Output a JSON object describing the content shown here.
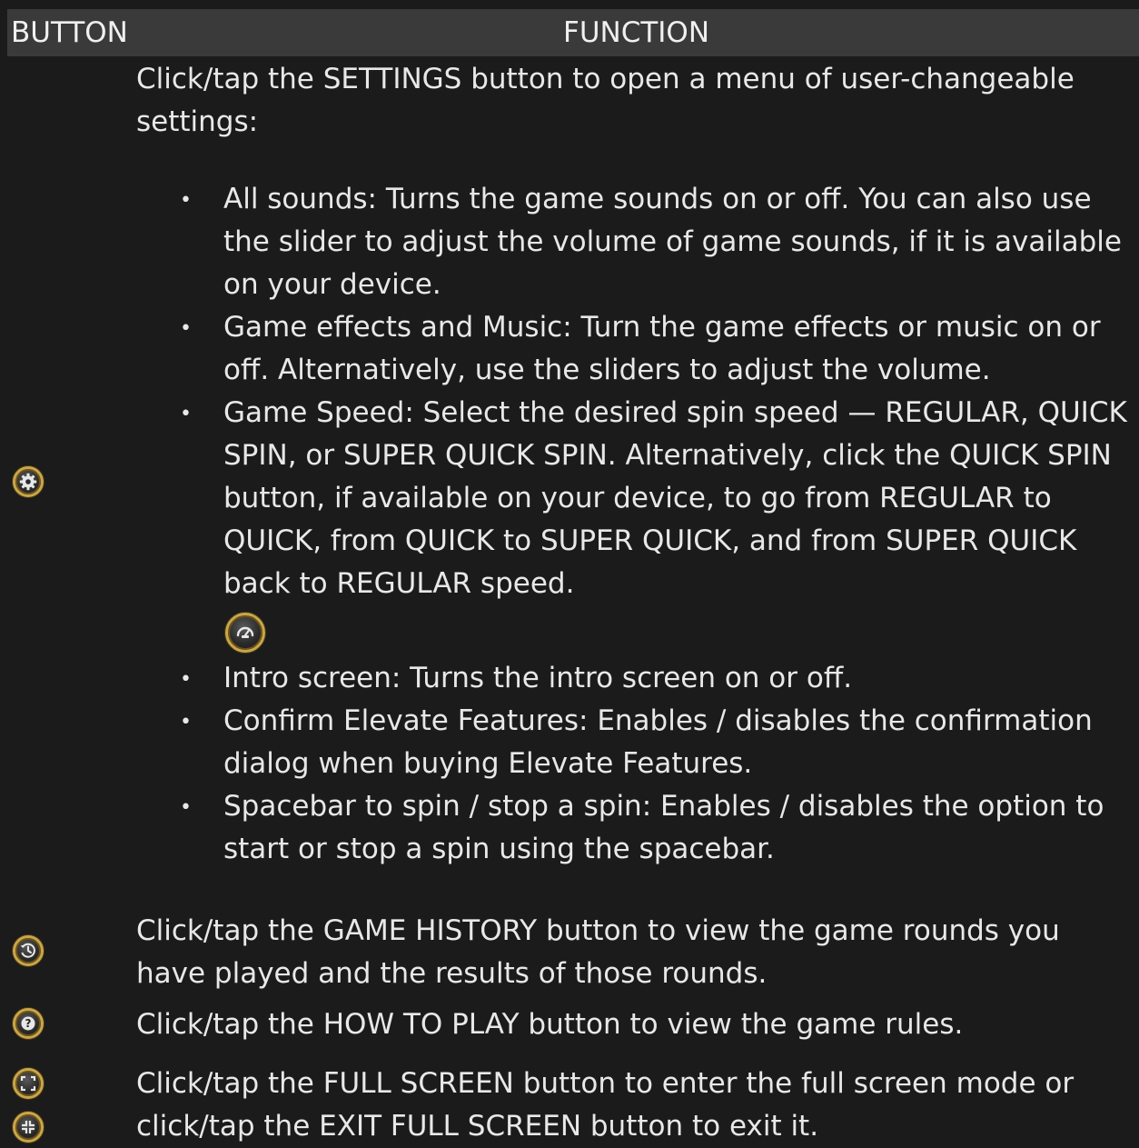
{
  "header": {
    "button_col": "BUTTON",
    "function_col": "FUNCTION"
  },
  "settings": {
    "icon": "settings-gear-icon",
    "intro_line1": "Click/tap the SETTINGS button to open a menu of user-changeable",
    "intro_line2": "settings:",
    "items": [
      {
        "lines": [
          "All sounds: Turns the game sounds on or off. You can also use",
          "the slider to adjust the volume of game sounds, if it is available",
          "on your device."
        ]
      },
      {
        "lines": [
          "Game effects and Music: Turn the game effects or music on or",
          "off. Alternatively, use the sliders to adjust the volume."
        ]
      },
      {
        "lines": [
          "Game Speed: Select the desired spin speed — REGULAR, QUICK",
          "SPIN, or SUPER QUICK SPIN. Alternatively, click the QUICK SPIN",
          "button, if available on your device, to go from REGULAR to",
          "QUICK, from QUICK to SUPER QUICK, and from SUPER QUICK",
          "back to REGULAR speed."
        ],
        "icon": "quick-spin-speedometer-icon"
      },
      {
        "lines": [
          "Intro screen: Turns the intro screen on or off."
        ]
      },
      {
        "lines": [
          "Confirm Elevate Features: Enables / disables the confirmation",
          "dialog when buying Elevate Features."
        ]
      },
      {
        "lines": [
          "Spacebar to spin / stop a spin: Enables / disables the option to",
          "start or stop a spin using the spacebar."
        ]
      }
    ]
  },
  "game_history": {
    "icon": "game-history-clock-icon",
    "lines": [
      "Click/tap the GAME HISTORY button to view the game rounds you",
      "have played and the results of those rounds."
    ]
  },
  "how_to_play": {
    "icon": "how-to-play-question-icon",
    "lines": [
      "Click/tap the HOW TO PLAY button to view the game rules."
    ]
  },
  "full_screen": {
    "icon_enter": "full-screen-icon",
    "icon_exit": "exit-full-screen-icon",
    "lines": [
      "Click/tap the FULL SCREEN button to enter the full screen mode or",
      "click/tap the EXIT FULL SCREEN button to exit it."
    ]
  },
  "colors": {
    "background": "#1b1b1b",
    "header_background": "#3a3a3a",
    "text": "#e8e8e8",
    "icon_ring": "#c9a64b"
  }
}
